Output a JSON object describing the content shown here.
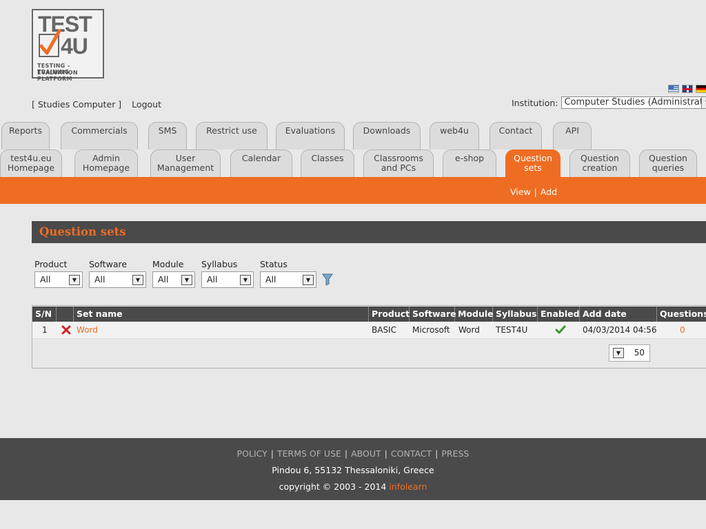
{
  "logo": {
    "word1": "TEST",
    "word2": "4U",
    "tagline1": "TESTING – TRAINING",
    "tagline2": "EVALUATION PLATFORM"
  },
  "header": {
    "user_label": "[ Studies Computer ]",
    "logout_label": "Logout",
    "institution_label": "Institution:",
    "institution_value": "Computer Studies (Administrator)",
    "flags": [
      "greek-flag-icon",
      "english-flag-icon",
      "german-flag-icon"
    ]
  },
  "tabs_row1": [
    {
      "label": "Reports"
    },
    {
      "label": "Commercials"
    },
    {
      "label": "SMS"
    },
    {
      "label": "Restrict use"
    },
    {
      "label": "Evaluations"
    },
    {
      "label": "Downloads"
    },
    {
      "label": "web4u"
    },
    {
      "label": "Contact"
    },
    {
      "label": "API"
    }
  ],
  "tabs_row2": [
    {
      "line1": "test4u.eu",
      "line2": "Homepage"
    },
    {
      "line1": "Admin",
      "line2": "Homepage"
    },
    {
      "line1": "User",
      "line2": "Management"
    },
    {
      "line1": "Calendar",
      "line2": ""
    },
    {
      "line1": "Classes",
      "line2": ""
    },
    {
      "line1": "Classrooms",
      "line2": "and PCs"
    },
    {
      "line1": "e-shop",
      "line2": ""
    },
    {
      "line1": "Question",
      "line2": "sets",
      "active": true
    },
    {
      "line1": "Question",
      "line2": "creation"
    },
    {
      "line1": "Question",
      "line2": "queries"
    }
  ],
  "subnav": {
    "view": "View",
    "separator": "|",
    "add": "Add"
  },
  "section": {
    "title": "Question sets"
  },
  "filters": {
    "product": {
      "label": "Product",
      "value": "All"
    },
    "software": {
      "label": "Software",
      "value": "All"
    },
    "module": {
      "label": "Module",
      "value": "All"
    },
    "syllabus": {
      "label": "Syllabus",
      "value": "All"
    },
    "status": {
      "label": "Status",
      "value": "All"
    }
  },
  "table": {
    "headers": {
      "sn": "S/N",
      "del": "",
      "set_name": "Set name",
      "product": "Product",
      "software": "Software",
      "module": "Module",
      "syllabus": "Syllabus",
      "enabled": "Enabled",
      "add_date": "Add date",
      "questions": "Questions"
    },
    "rows": [
      {
        "sn": "1",
        "set_name": "Word",
        "product": "BASIC",
        "software": "Microsoft",
        "module": "Word",
        "syllabus": "TEST4U",
        "enabled": true,
        "add_date": "04/03/2014 04:56",
        "questions": "0"
      }
    ],
    "page_size": "50"
  },
  "footer": {
    "links": [
      "POLICY",
      "TERMS OF USE",
      "ABOUT",
      "CONTACT",
      "PRESS"
    ],
    "address": "Pindou 6, 55132 Thessaloniki, Greece",
    "copyright": "copyright © 2003 - 2014",
    "brand": "infolearn"
  },
  "colors": {
    "accent": "#ee6d23",
    "dark": "#4a4a4a",
    "background": "#e8e8e8"
  }
}
